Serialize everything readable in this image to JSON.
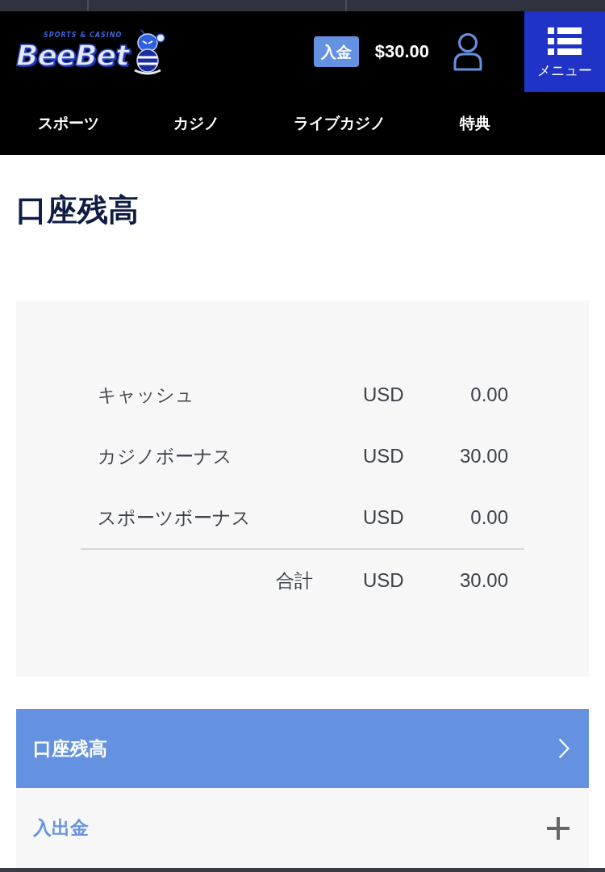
{
  "header": {
    "logo": {
      "wordmark": "BeeBet",
      "tagline": "SPORTS & CASINO"
    },
    "deposit_badge": "入金",
    "balance": "$30.00",
    "menu_button": {
      "label": "メニュー"
    }
  },
  "nav": [
    "スポーツ",
    "カジノ",
    "ライブカジノ",
    "特典"
  ],
  "page_title": "口座残高",
  "balance_table": {
    "rows": [
      {
        "label": "キャッシュ",
        "currency": "USD",
        "amount": "0.00"
      },
      {
        "label": "カジノボーナス",
        "currency": "USD",
        "amount": "30.00"
      },
      {
        "label": "スポーツボーナス",
        "currency": "USD",
        "amount": "0.00"
      }
    ],
    "total": {
      "label": "合計",
      "currency": "USD",
      "amount": "30.00"
    }
  },
  "account_menu": [
    {
      "label": "口座残高",
      "kind": "link",
      "selected": true
    },
    {
      "label": "入出金",
      "kind": "group",
      "selected": false,
      "expanded": false
    }
  ]
}
